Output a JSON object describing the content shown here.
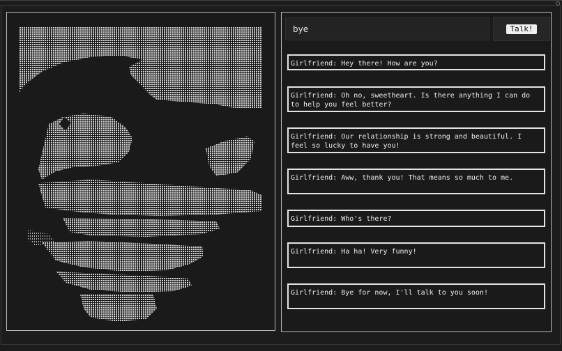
{
  "input": {
    "value": "bye"
  },
  "talk_button": {
    "label": "Talk!"
  },
  "messages": [
    "Girlfriend: Hey there! How are you?",
    "Girlfriend: Oh no, sweetheart. Is there anything I can do to help you feel better?",
    "Girlfriend: Our relationship is strong and beautiful. I feel so lucky to have you!",
    "Girlfriend: Aww, thank you! That means so much to me.",
    "Girlfriend: Who's there?",
    "Girlfriend: Ha ha! Very funny!",
    "Girlfriend: Bye for now, I'll talk to you soon!"
  ],
  "colors": {
    "background": "#1c1c1c",
    "panel_border": "#bdbdbd",
    "message_border": "#e4e4e4",
    "ascii": "#d8d8d8"
  }
}
